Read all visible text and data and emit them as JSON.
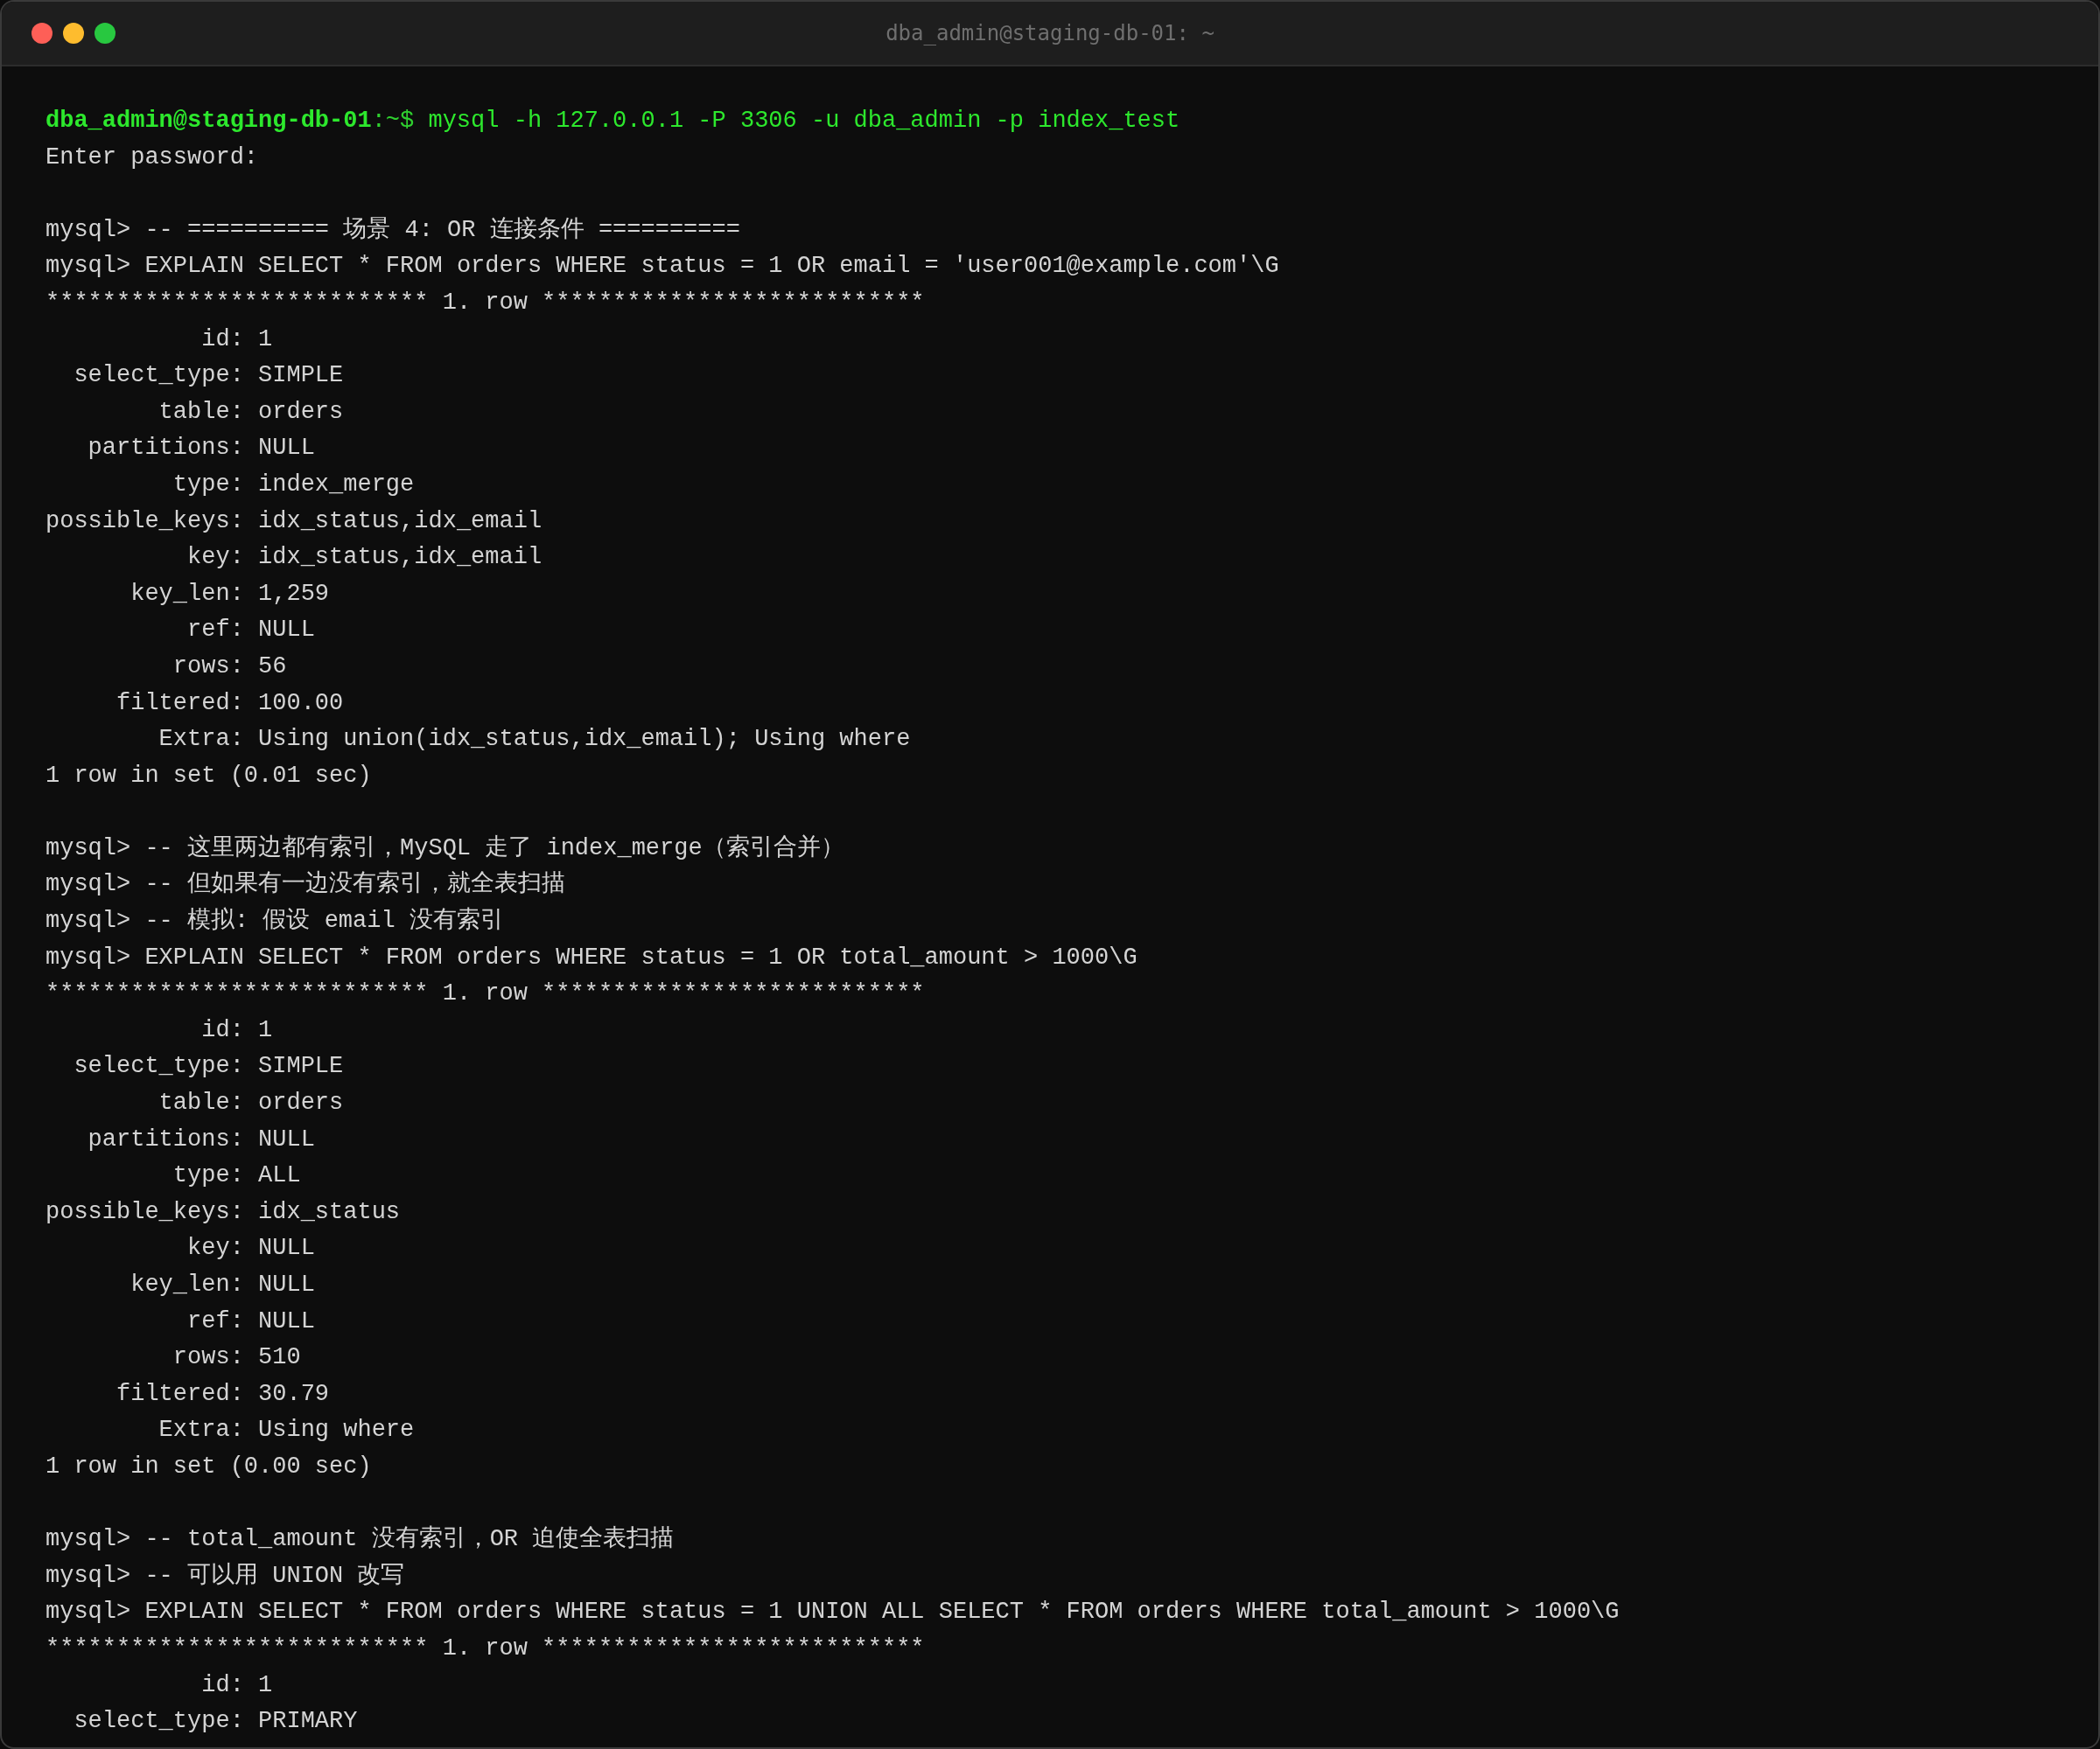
{
  "window": {
    "title": "dba_admin@staging-db-01: ~"
  },
  "terminal": {
    "lines": [
      {
        "kind": "prompt",
        "user_host": "dba_admin@staging-db-01",
        "path": ":~$",
        "command": "mysql -h 127.0.0.1 -P 3306 -u dba_admin -p index_test"
      },
      {
        "kind": "output",
        "text": "Enter password:"
      },
      {
        "kind": "blank"
      },
      {
        "kind": "output",
        "text": "mysql> -- ========== 场景 4: OR 连接条件 =========="
      },
      {
        "kind": "output",
        "text": "mysql> EXPLAIN SELECT * FROM orders WHERE status = 1 OR email = 'user001@example.com'\\G"
      },
      {
        "kind": "output",
        "text": "*************************** 1. row ***************************"
      },
      {
        "kind": "output",
        "text": "           id: 1"
      },
      {
        "kind": "output",
        "text": "  select_type: SIMPLE"
      },
      {
        "kind": "output",
        "text": "        table: orders"
      },
      {
        "kind": "output",
        "text": "   partitions: NULL"
      },
      {
        "kind": "output",
        "text": "         type: index_merge"
      },
      {
        "kind": "output",
        "text": "possible_keys: idx_status,idx_email"
      },
      {
        "kind": "output",
        "text": "          key: idx_status,idx_email"
      },
      {
        "kind": "output",
        "text": "      key_len: 1,259"
      },
      {
        "kind": "output",
        "text": "          ref: NULL"
      },
      {
        "kind": "output",
        "text": "         rows: 56"
      },
      {
        "kind": "output",
        "text": "     filtered: 100.00"
      },
      {
        "kind": "output",
        "text": "        Extra: Using union(idx_status,idx_email); Using where"
      },
      {
        "kind": "output",
        "text": "1 row in set (0.01 sec)"
      },
      {
        "kind": "blank"
      },
      {
        "kind": "output",
        "text": "mysql> -- 这里两边都有索引，MySQL 走了 index_merge（索引合并）"
      },
      {
        "kind": "output",
        "text": "mysql> -- 但如果有一边没有索引，就全表扫描"
      },
      {
        "kind": "output",
        "text": "mysql> -- 模拟: 假设 email 没有索引"
      },
      {
        "kind": "output",
        "text": "mysql> EXPLAIN SELECT * FROM orders WHERE status = 1 OR total_amount > 1000\\G"
      },
      {
        "kind": "output",
        "text": "*************************** 1. row ***************************"
      },
      {
        "kind": "output",
        "text": "           id: 1"
      },
      {
        "kind": "output",
        "text": "  select_type: SIMPLE"
      },
      {
        "kind": "output",
        "text": "        table: orders"
      },
      {
        "kind": "output",
        "text": "   partitions: NULL"
      },
      {
        "kind": "output",
        "text": "         type: ALL"
      },
      {
        "kind": "output",
        "text": "possible_keys: idx_status"
      },
      {
        "kind": "output",
        "text": "          key: NULL"
      },
      {
        "kind": "output",
        "text": "      key_len: NULL"
      },
      {
        "kind": "output",
        "text": "          ref: NULL"
      },
      {
        "kind": "output",
        "text": "         rows: 510"
      },
      {
        "kind": "output",
        "text": "     filtered: 30.79"
      },
      {
        "kind": "output",
        "text": "        Extra: Using where"
      },
      {
        "kind": "output",
        "text": "1 row in set (0.00 sec)"
      },
      {
        "kind": "blank"
      },
      {
        "kind": "output",
        "text": "mysql> -- total_amount 没有索引，OR 迫使全表扫描"
      },
      {
        "kind": "output",
        "text": "mysql> -- 可以用 UNION 改写"
      },
      {
        "kind": "output",
        "text": "mysql> EXPLAIN SELECT * FROM orders WHERE status = 1 UNION ALL SELECT * FROM orders WHERE total_amount > 1000\\G"
      },
      {
        "kind": "output",
        "text": "*************************** 1. row ***************************"
      },
      {
        "kind": "output",
        "text": "           id: 1"
      },
      {
        "kind": "output",
        "text": "  select_type: PRIMARY"
      }
    ]
  }
}
